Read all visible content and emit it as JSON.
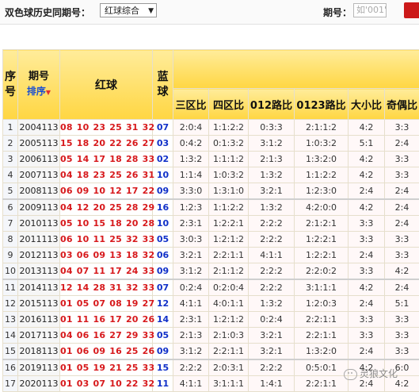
{
  "filter": {
    "label": "双色球历史同期号：",
    "select_value": "红球综合",
    "issue_label": "期号：",
    "issue_placeholder": "如'001'"
  },
  "table": {
    "headers": {
      "seq": "序号",
      "period": "期号",
      "sort": "排序",
      "red": "红球",
      "blue": "蓝球",
      "ratios": [
        "三区比",
        "四区比",
        "012路比",
        "0123路比",
        "大小比",
        "奇偶比"
      ]
    },
    "rows": [
      {
        "seq": "1",
        "period": "2004113",
        "red": "08 10 23 25 31 32",
        "blue": "07",
        "ratios": [
          "2:0:4",
          "1:1:2:2",
          "0:3:3",
          "2:1:1:2",
          "4:2",
          "3:3"
        ]
      },
      {
        "seq": "2",
        "period": "2005113",
        "red": "15 18 20 22 26 27",
        "blue": "03",
        "ratios": [
          "0:4:2",
          "0:1:3:2",
          "3:1:2",
          "1:0:3:2",
          "5:1",
          "2:4"
        ]
      },
      {
        "seq": "3",
        "period": "2006113",
        "red": "05 14 17 18 28 33",
        "blue": "02",
        "ratios": [
          "1:3:2",
          "1:1:1:2",
          "2:1:3",
          "1:3:2:0",
          "4:2",
          "3:3"
        ]
      },
      {
        "seq": "4",
        "period": "2007113",
        "red": "04 18 23 25 26 31",
        "blue": "10",
        "ratios": [
          "1:1:4",
          "1:0:3:2",
          "1:3:2",
          "1:1:2:2",
          "4:2",
          "3:3"
        ]
      },
      {
        "seq": "5",
        "period": "2008113",
        "red": "06 09 10 12 17 22",
        "blue": "09",
        "ratios": [
          "3:3:0",
          "1:3:1:0",
          "3:2:1",
          "1:2:3:0",
          "2:4",
          "2:4"
        ]
      },
      {
        "seq": "6",
        "period": "2009113",
        "red": "04 12 20 25 28 29",
        "blue": "16",
        "ratios": [
          "1:2:3",
          "1:1:2:2",
          "1:3:2",
          "4:2:0:0",
          "4:2",
          "2:4"
        ]
      },
      {
        "seq": "7",
        "period": "2010113",
        "red": "05 10 15 18 20 28",
        "blue": "10",
        "ratios": [
          "2:3:1",
          "1:2:2:1",
          "2:2:2",
          "2:1:2:1",
          "3:3",
          "2:4"
        ]
      },
      {
        "seq": "8",
        "period": "2011113",
        "red": "06 10 11 25 32 33",
        "blue": "05",
        "ratios": [
          "3:0:3",
          "1:2:1:2",
          "2:2:2",
          "1:2:2:1",
          "3:3",
          "3:3"
        ]
      },
      {
        "seq": "9",
        "period": "2012113",
        "red": "03 06 09 13 18 32",
        "blue": "06",
        "ratios": [
          "3:2:1",
          "2:2:1:1",
          "4:1:1",
          "1:2:2:1",
          "2:4",
          "3:3"
        ]
      },
      {
        "seq": "10",
        "period": "2013113",
        "red": "04 07 11 17 24 33",
        "blue": "09",
        "ratios": [
          "3:1:2",
          "2:1:1:2",
          "2:2:2",
          "2:2:0:2",
          "3:3",
          "4:2"
        ]
      },
      {
        "seq": "11",
        "period": "2014113",
        "red": "12 14 28 31 32 33",
        "blue": "07",
        "ratios": [
          "0:2:4",
          "0:2:0:4",
          "2:2:2",
          "3:1:1:1",
          "4:2",
          "2:4"
        ]
      },
      {
        "seq": "12",
        "period": "2015113",
        "red": "01 05 07 08 19 27",
        "blue": "12",
        "ratios": [
          "4:1:1",
          "4:0:1:1",
          "1:3:2",
          "1:2:0:3",
          "2:4",
          "5:1"
        ]
      },
      {
        "seq": "13",
        "period": "2016113",
        "red": "01 11 16 17 20 26",
        "blue": "14",
        "ratios": [
          "2:3:1",
          "1:2:1:2",
          "0:2:4",
          "2:2:1:1",
          "3:3",
          "3:3"
        ]
      },
      {
        "seq": "14",
        "period": "2017113",
        "red": "04 06 16 27 29 33",
        "blue": "05",
        "ratios": [
          "2:1:3",
          "2:1:0:3",
          "3:2:1",
          "2:2:1:1",
          "3:3",
          "3:3"
        ]
      },
      {
        "seq": "15",
        "period": "2018113",
        "red": "01 06 09 16 25 26",
        "blue": "09",
        "ratios": [
          "3:1:2",
          "2:2:1:1",
          "3:2:1",
          "1:3:2:0",
          "2:4",
          "3:3"
        ]
      },
      {
        "seq": "16",
        "period": "2019113",
        "red": "01 05 19 21 25 33",
        "blue": "15",
        "ratios": [
          "2:2:2",
          "2:0:3:1",
          "2:2:2",
          "0:5:0:1",
          "4:2",
          "6:0"
        ]
      },
      {
        "seq": "17",
        "period": "2020113",
        "red": "01 03 07 10 22 32",
        "blue": "11",
        "ratios": [
          "4:1:1",
          "3:1:1:1",
          "1:4:1",
          "2:2:1:1",
          "2:4",
          "4:2"
        ]
      }
    ]
  },
  "watermark": "灵狼文化"
}
